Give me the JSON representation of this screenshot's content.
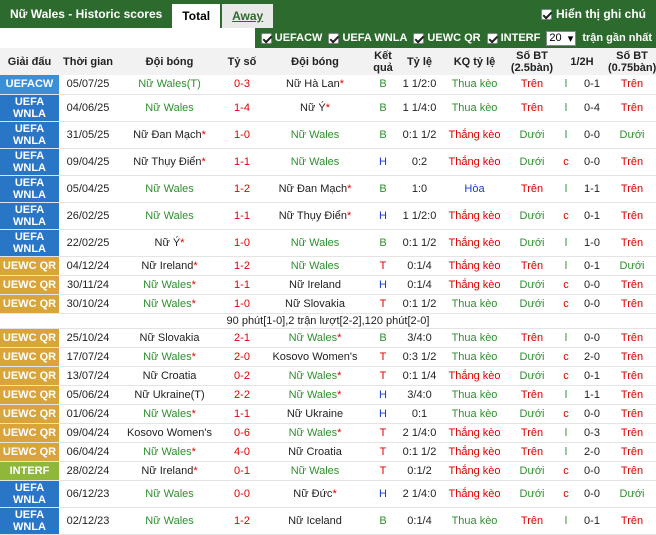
{
  "header": {
    "title": "Nữ Wales - Historic scores",
    "tabs": [
      "Total",
      "Away"
    ],
    "show_notes": "Hiển thị ghi chú"
  },
  "filters": {
    "items": [
      "UEFACW",
      "UEFA WNLA",
      "UEWC QR",
      "INTERF"
    ],
    "count": "20",
    "suffix": "trận gần nhất"
  },
  "columns": [
    "Giải đấu",
    "Thời gian",
    "Đội bóng",
    "Tỷ số",
    "Đội bóng",
    "Kết quả",
    "Tỷ lệ",
    "KQ tỷ lệ",
    "Số BT (2.5bàn)",
    "1/2H",
    "Số BT (0.75bàn)"
  ],
  "colors": {
    "UEFACW": "#3a8fd8",
    "UEFA WNLA": "#2a76c6",
    "UEWC QR": "#d9a43a",
    "INTERF": "#8fb83a"
  },
  "rows": [
    {
      "league": "UEFACW",
      "date": "05/07/25",
      "home": "Nữ Wales(T)",
      "home_star": false,
      "score": "0-3",
      "away": "Nữ Hà Lan",
      "away_star": true,
      "res": "B",
      "odds": "1 1/2:0",
      "kq": "Thua kèo",
      "bt": "Trên",
      "h": "l",
      "ht": "0-1",
      "bt2": "Trên",
      "tall": false,
      "wales": "home"
    },
    {
      "league": "UEFA WNLA",
      "date": "04/06/25",
      "home": "Nữ Wales",
      "home_star": false,
      "score": "1-4",
      "away": "Nữ Ý",
      "away_star": true,
      "res": "B",
      "odds": "1 1/4:0",
      "kq": "Thua kèo",
      "bt": "Trên",
      "h": "l",
      "ht": "0-4",
      "bt2": "Trên",
      "tall": true,
      "wales": "home"
    },
    {
      "league": "UEFA WNLA",
      "date": "31/05/25",
      "home": "Nữ Đan Mạch",
      "home_star": true,
      "score": "1-0",
      "away": "Nữ Wales",
      "away_star": false,
      "res": "B",
      "odds": "0:1 1/2",
      "kq": "Thắng kèo",
      "bt": "Dưới",
      "h": "l",
      "ht": "0-0",
      "bt2": "Dưới",
      "tall": true,
      "wales": "away"
    },
    {
      "league": "UEFA WNLA",
      "date": "09/04/25",
      "home": "Nữ Thụy Điển",
      "home_star": true,
      "score": "1-1",
      "away": "Nữ Wales",
      "away_star": false,
      "res": "H",
      "odds": "0:2",
      "kq": "Thắng kèo",
      "bt": "Dưới",
      "h": "c",
      "ht": "0-0",
      "bt2": "Trên",
      "tall": true,
      "wales": "away"
    },
    {
      "league": "UEFA WNLA",
      "date": "05/04/25",
      "home": "Nữ Wales",
      "home_star": false,
      "score": "1-2",
      "away": "Nữ Đan Mạch",
      "away_star": true,
      "res": "B",
      "odds": "1:0",
      "kq": "Hòa",
      "bt": "Trên",
      "h": "l",
      "ht": "1-1",
      "bt2": "Trên",
      "tall": true,
      "wales": "home"
    },
    {
      "league": "UEFA WNLA",
      "date": "26/02/25",
      "home": "Nữ Wales",
      "home_star": false,
      "score": "1-1",
      "away": "Nữ Thụy Điển",
      "away_star": true,
      "res": "H",
      "odds": "1 1/2:0",
      "kq": "Thắng kèo",
      "bt": "Dưới",
      "h": "c",
      "ht": "0-1",
      "bt2": "Trên",
      "tall": true,
      "wales": "home"
    },
    {
      "league": "UEFA WNLA",
      "date": "22/02/25",
      "home": "Nữ Ý",
      "home_star": true,
      "score": "1-0",
      "away": "Nữ Wales",
      "away_star": false,
      "res": "B",
      "odds": "0:1 1/2",
      "kq": "Thắng kèo",
      "bt": "Dưới",
      "h": "l",
      "ht": "1-0",
      "bt2": "Trên",
      "tall": true,
      "wales": "away"
    },
    {
      "league": "UEWC QR",
      "date": "04/12/24",
      "home": "Nữ Ireland",
      "home_star": true,
      "score": "1-2",
      "away": "Nữ Wales",
      "away_star": false,
      "res": "T",
      "odds": "0:1/4",
      "kq": "Thắng kèo",
      "bt": "Trên",
      "h": "l",
      "ht": "0-1",
      "bt2": "Dưới",
      "tall": false,
      "wales": "away"
    },
    {
      "league": "UEWC QR",
      "date": "30/11/24",
      "home": "Nữ Wales",
      "home_star": true,
      "score": "1-1",
      "away": "Nữ Ireland",
      "away_star": false,
      "res": "H",
      "odds": "0:1/4",
      "kq": "Thắng kèo",
      "bt": "Dưới",
      "h": "c",
      "ht": "0-0",
      "bt2": "Trên",
      "tall": false,
      "wales": "home"
    },
    {
      "league": "UEWC QR",
      "date": "30/10/24",
      "home": "Nữ Wales",
      "home_star": true,
      "score": "1-0",
      "away": "Nữ Slovakia",
      "away_star": false,
      "res": "T",
      "odds": "0:1 1/2",
      "kq": "Thua kèo",
      "bt": "Dưới",
      "h": "c",
      "ht": "0-0",
      "bt2": "Trên",
      "tall": false,
      "wales": "home",
      "note": "90 phút[1-0],2 trận lượt[2-2],120 phút[2-0]"
    },
    {
      "league": "UEWC QR",
      "date": "25/10/24",
      "home": "Nữ Slovakia",
      "home_star": false,
      "score": "2-1",
      "away": "Nữ Wales",
      "away_star": true,
      "res": "B",
      "odds": "3/4:0",
      "kq": "Thua kèo",
      "bt": "Trên",
      "h": "l",
      "ht": "0-0",
      "bt2": "Trên",
      "tall": false,
      "wales": "away"
    },
    {
      "league": "UEWC QR",
      "date": "17/07/24",
      "home": "Nữ Wales",
      "home_star": true,
      "score": "2-0",
      "away": "Kosovo Women's",
      "away_star": false,
      "res": "T",
      "odds": "0:3 1/2",
      "kq": "Thua kèo",
      "bt": "Dưới",
      "h": "c",
      "ht": "2-0",
      "bt2": "Trên",
      "tall": false,
      "wales": "home"
    },
    {
      "league": "UEWC QR",
      "date": "13/07/24",
      "home": "Nữ Croatia",
      "home_star": false,
      "score": "0-2",
      "away": "Nữ Wales",
      "away_star": true,
      "res": "T",
      "odds": "0:1 1/4",
      "kq": "Thắng kèo",
      "bt": "Dưới",
      "h": "c",
      "ht": "0-1",
      "bt2": "Trên",
      "tall": false,
      "wales": "away"
    },
    {
      "league": "UEWC QR",
      "date": "05/06/24",
      "home": "Nữ Ukraine(T)",
      "home_star": false,
      "score": "2-2",
      "away": "Nữ Wales",
      "away_star": true,
      "res": "H",
      "odds": "3/4:0",
      "kq": "Thua kèo",
      "bt": "Trên",
      "h": "l",
      "ht": "1-1",
      "bt2": "Trên",
      "tall": false,
      "wales": "away"
    },
    {
      "league": "UEWC QR",
      "date": "01/06/24",
      "home": "Nữ Wales",
      "home_star": true,
      "score": "1-1",
      "away": "Nữ Ukraine",
      "away_star": false,
      "res": "H",
      "odds": "0:1",
      "kq": "Thua kèo",
      "bt": "Dưới",
      "h": "c",
      "ht": "0-0",
      "bt2": "Trên",
      "tall": false,
      "wales": "home"
    },
    {
      "league": "UEWC QR",
      "date": "09/04/24",
      "home": "Kosovo Women's",
      "home_star": false,
      "score": "0-6",
      "away": "Nữ Wales",
      "away_star": true,
      "res": "T",
      "odds": "2 1/4:0",
      "kq": "Thắng kèo",
      "bt": "Trên",
      "h": "l",
      "ht": "0-3",
      "bt2": "Trên",
      "tall": false,
      "wales": "away"
    },
    {
      "league": "UEWC QR",
      "date": "06/04/24",
      "home": "Nữ Wales",
      "home_star": true,
      "score": "4-0",
      "away": "Nữ Croatia",
      "away_star": false,
      "res": "T",
      "odds": "0:1 1/2",
      "kq": "Thắng kèo",
      "bt": "Trên",
      "h": "l",
      "ht": "2-0",
      "bt2": "Trên",
      "tall": false,
      "wales": "home"
    },
    {
      "league": "INTERF",
      "date": "28/02/24",
      "home": "Nữ Ireland",
      "home_star": true,
      "score": "0-1",
      "away": "Nữ Wales",
      "away_star": false,
      "res": "T",
      "odds": "0:1/2",
      "kq": "Thắng kèo",
      "bt": "Dưới",
      "h": "c",
      "ht": "0-0",
      "bt2": "Trên",
      "tall": false,
      "wales": "away"
    },
    {
      "league": "UEFA WNLA",
      "date": "06/12/23",
      "home": "Nữ Wales",
      "home_star": false,
      "score": "0-0",
      "away": "Nữ Đức",
      "away_star": true,
      "res": "H",
      "odds": "2 1/4:0",
      "kq": "Thắng kèo",
      "bt": "Dưới",
      "h": "c",
      "ht": "0-0",
      "bt2": "Dưới",
      "tall": true,
      "wales": "home"
    },
    {
      "league": "UEFA WNLA",
      "date": "02/12/23",
      "home": "Nữ Wales",
      "home_star": false,
      "score": "1-2",
      "away": "Nữ Iceland",
      "away_star": false,
      "res": "B",
      "odds": "0:1/4",
      "kq": "Thua kèo",
      "bt": "Trên",
      "h": "l",
      "ht": "0-1",
      "bt2": "Trên",
      "tall": true,
      "wales": "home"
    }
  ]
}
